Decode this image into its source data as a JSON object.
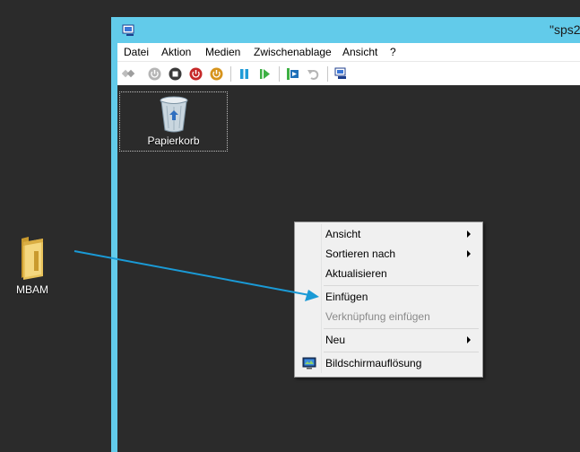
{
  "host_desktop": {
    "folder_label": "MBAM"
  },
  "vm_window": {
    "title": "\"sps2"
  },
  "menubar": [
    "Datei",
    "Aktion",
    "Medien",
    "Zwischenablage",
    "Ansicht",
    "?"
  ],
  "toolbar": {
    "icons": [
      "ctrl-alt-del-icon",
      "start-icon",
      "turn-off-icon",
      "shut-down-icon",
      "save-icon",
      "pause-icon",
      "resume-icon",
      "checkpoint-icon",
      "revert-icon",
      "enhanced-session-icon"
    ]
  },
  "guest_desktop": {
    "recycle_bin_label": "Papierkorb"
  },
  "context_menu": {
    "items": [
      {
        "label": "Ansicht",
        "submenu": true,
        "disabled": false
      },
      {
        "label": "Sortieren nach",
        "submenu": true,
        "disabled": false
      },
      {
        "label": "Aktualisieren",
        "submenu": false,
        "disabled": false
      },
      {
        "label": "Einfügen",
        "submenu": false,
        "disabled": false
      },
      {
        "label": "Verknüpfung einfügen",
        "submenu": false,
        "disabled": true
      },
      {
        "label": "Neu",
        "submenu": true,
        "disabled": false
      },
      {
        "label": "Bildschirmauflösung",
        "submenu": false,
        "disabled": false,
        "icon": "display-settings-icon"
      }
    ]
  },
  "annotation": {
    "type": "arrow",
    "color": "#1a9ad6"
  },
  "colors": {
    "window_frame": "#62cbea",
    "desktop": "#2b2b2b",
    "menu_bg": "#f0f0f0"
  }
}
